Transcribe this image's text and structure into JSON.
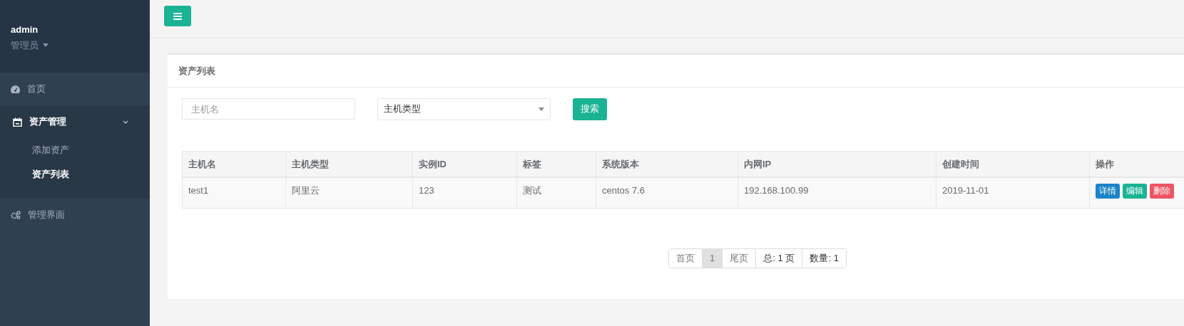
{
  "sidebar": {
    "user": {
      "name": "admin",
      "role": "管理员"
    },
    "items": [
      {
        "label": "首页",
        "selected": false
      },
      {
        "label": "资产管理",
        "selected": true,
        "expanded": true,
        "children": [
          {
            "label": "添加资产",
            "selected": false
          },
          {
            "label": "资产列表",
            "selected": true
          }
        ]
      },
      {
        "label": "管理界面",
        "selected": false
      }
    ]
  },
  "card": {
    "title": "资产列表",
    "filters": {
      "hostname": {
        "placeholder": "主机名"
      },
      "host_type": {
        "value": "主机类型"
      },
      "search_button": "搜索"
    },
    "table": {
      "columns": [
        "主机名",
        "主机类型",
        "实例ID",
        "标签",
        "系统版本",
        "内网IP",
        "创建时间",
        "操作"
      ],
      "rows": [
        {
          "cells": [
            "test1",
            "阿里云",
            "123",
            "测试",
            "centos 7.6",
            "192.168.100.99",
            "2019-11-01"
          ],
          "actions": [
            {
              "label": "详情",
              "kind": "info"
            },
            {
              "label": "编辑",
              "kind": "primary"
            },
            {
              "label": "删除",
              "kind": "danger"
            }
          ]
        }
      ]
    },
    "pagination": [
      {
        "label": "首页",
        "kind": "link",
        "selected": false
      },
      {
        "label": "1",
        "kind": "link",
        "selected": true
      },
      {
        "label": "尾页",
        "kind": "link",
        "selected": false
      },
      {
        "label": "总: 1 页",
        "kind": "info",
        "selected": false
      },
      {
        "label": "数量: 1",
        "kind": "info",
        "selected": false
      }
    ]
  }
}
